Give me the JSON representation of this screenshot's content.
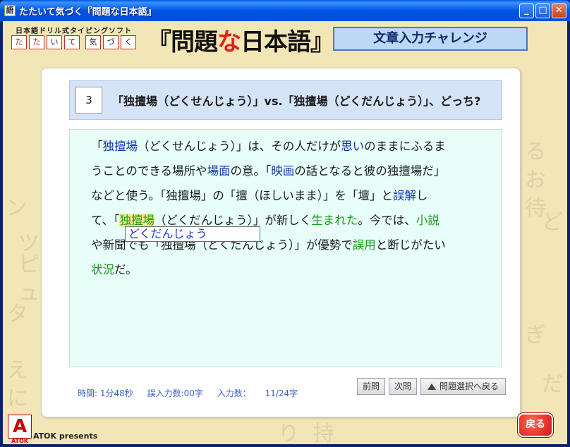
{
  "window": {
    "title": "たたいて気づく『問題な日本語』",
    "minimize": "_",
    "maximize": "□",
    "close": "✕"
  },
  "header": {
    "subtitle": "日本語ドリル式タイピングソフト",
    "kana_boxes": [
      "た",
      "た",
      "い",
      "て",
      "気",
      "づ",
      "く"
    ],
    "logo": {
      "pre": "『問題",
      "na": "な",
      "post": "日本語』"
    },
    "challenge_label": "文章入力チャレンジ"
  },
  "question": {
    "number": "3",
    "title": "「独擅場（どくせんじょう）」vs.「独擅場（どくだんじょう）」、どっち?"
  },
  "passage": {
    "line1": [
      {
        "t": "「",
        "c": ""
      },
      {
        "t": "独擅場",
        "c": "b"
      },
      {
        "t": "（どくせんじょう）」は、その人だけが",
        "c": ""
      },
      {
        "t": "思い",
        "c": "b"
      },
      {
        "t": "のままにふるま",
        "c": ""
      }
    ],
    "line2": [
      {
        "t": "うことのできる場所や",
        "c": ""
      },
      {
        "t": "場面",
        "c": "b"
      },
      {
        "t": "の意。「",
        "c": ""
      },
      {
        "t": "映画",
        "c": "b"
      },
      {
        "t": "の話となると彼の独擅場だ」",
        "c": ""
      }
    ],
    "line3": [
      {
        "t": "などと使う。「独擅場」の「擅（ほしいまま）」を「壇」と",
        "c": ""
      },
      {
        "t": "誤解",
        "c": "b"
      },
      {
        "t": "し",
        "c": ""
      }
    ],
    "line4": [
      {
        "t": "て、「",
        "c": ""
      },
      {
        "t": "独擅場",
        "c": "cur"
      },
      {
        "t": "（どくだんじょう）」が新しく",
        "c": ""
      },
      {
        "t": "生まれた",
        "c": "g"
      },
      {
        "t": "。今では、",
        "c": ""
      },
      {
        "t": "小説",
        "c": "g"
      }
    ],
    "line5": [
      {
        "t": "や新聞でも「独擅場（どくだんじょう）」が優勢で",
        "c": ""
      },
      {
        "t": "誤用",
        "c": "g"
      },
      {
        "t": "と断じがたい",
        "c": ""
      }
    ],
    "line6": [
      {
        "t": "状況",
        "c": "g"
      },
      {
        "t": "だ。",
        "c": ""
      }
    ],
    "ime_candidate": "どくだんじょう"
  },
  "status": {
    "time": "時間: 1分48秒",
    "errors": "誤入力数:00字",
    "count_label": "入力数：",
    "count": "11/24字"
  },
  "buttons": {
    "prev": "前問",
    "next": "次問",
    "back_to_select": "問題選択へ戻る",
    "back": "戻る"
  },
  "footer": {
    "atok_mark": "A",
    "atok_small": "ATOK",
    "presents": "ATOK presents"
  },
  "background_glyphs": [
    "ン",
    "タ",
    "ツ",
    "ピ",
    "ュ",
    "ー",
    "え",
    "に",
    "る",
    "お",
    "待",
    "ち",
    "ど",
    "だ",
    "ぎ",
    "ょ",
    "持",
    "り"
  ]
}
